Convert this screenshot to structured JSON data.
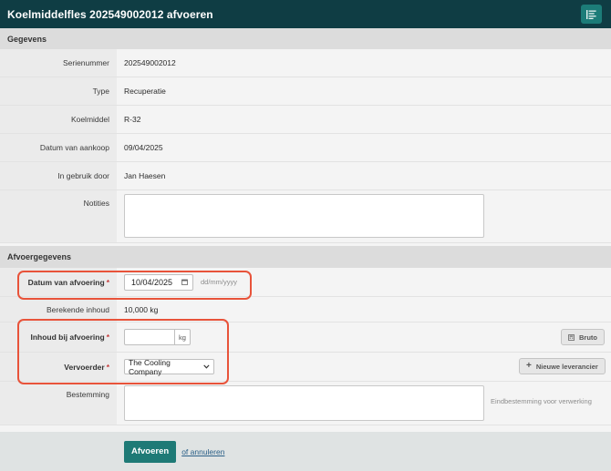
{
  "header": {
    "title": "Koelmiddelfles 202549002012 afvoeren",
    "action_icon": "form-list-icon"
  },
  "sections": {
    "gegevens": "Gegevens",
    "afvoer": "Afvoergegevens"
  },
  "details": [
    {
      "label": "Serienummer",
      "value": "202549002012"
    },
    {
      "label": "Type",
      "value": "Recuperatie"
    },
    {
      "label": "Koelmiddel",
      "value": "R-32"
    },
    {
      "label": "Datum van aankoop",
      "value": "09/04/2025"
    },
    {
      "label": "In gebruik door",
      "value": "Jan Haesen"
    }
  ],
  "notities": {
    "label": "Notities",
    "value": ""
  },
  "afvoer": {
    "datum": {
      "label": "Datum van afvoering",
      "value": "10/04/2025",
      "hint": "dd/mm/yyyy"
    },
    "berekend": {
      "label": "Berekende inhoud",
      "value": "10,000 kg"
    },
    "inhoud": {
      "label": "Inhoud bij afvoering",
      "value": "",
      "unit": "kg",
      "bruto_label": "Bruto"
    },
    "vervoerder": {
      "label": "Vervoerder",
      "value": "The Cooling Company",
      "new_label": "Nieuwe leverancier"
    },
    "bestemming": {
      "label": "Bestemming",
      "value": "",
      "hint": "Eindbestemming voor verwerking"
    }
  },
  "required_mark": "*",
  "footer": {
    "submit_label": "Afvoeren",
    "cancel_label": "of annuleren"
  },
  "colors": {
    "header_bg": "#0f3d44",
    "accent": "#1e7a76",
    "highlight": "#e8533a",
    "required": "#c63b3b"
  }
}
